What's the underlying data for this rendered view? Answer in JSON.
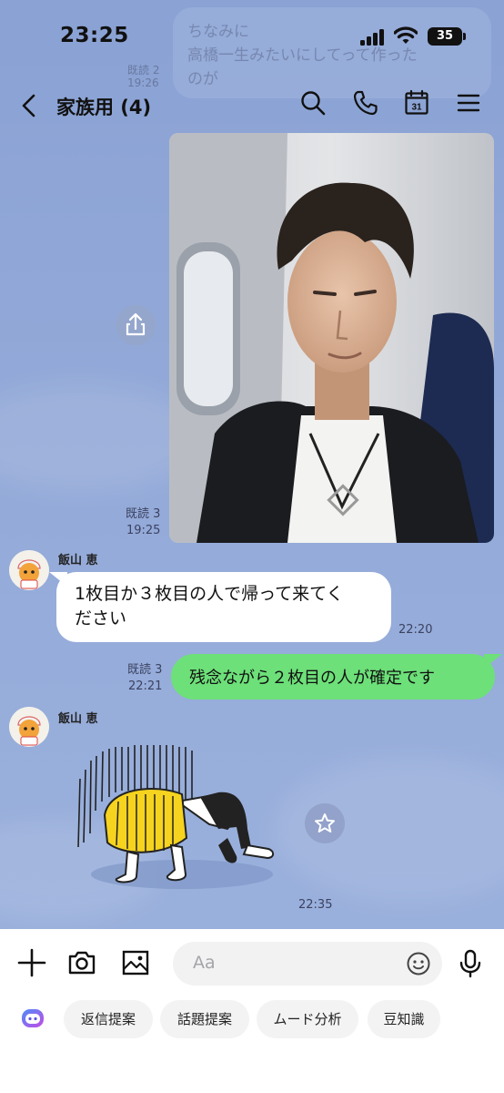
{
  "status_bar": {
    "time": "23:25",
    "battery": "35"
  },
  "ghost": {
    "lines": [
      "ちなみに",
      "高橋一生みたいにしてって作った",
      "のが"
    ],
    "read": "既読 2",
    "time": "19:26"
  },
  "header": {
    "title": "家族用 (4)"
  },
  "messages": {
    "photo_meta": {
      "read": "既読 3",
      "time": "19:25"
    },
    "incoming_1": {
      "sender": "飯山 恵",
      "lines": [
        "1枚目か３枚目の人で帰って来てく",
        "ださい"
      ],
      "time": "22:20"
    },
    "outgoing_1": {
      "text": "残念ながら２枚目の人が確定です",
      "read": "既読 3",
      "time": "22:21"
    },
    "incoming_2": {
      "sender": "飯山 恵",
      "time": "22:35"
    }
  },
  "input": {
    "placeholder": "Aa"
  },
  "suggestions": [
    "返信提案",
    "話題提案",
    "ムード分析",
    "豆知識"
  ],
  "colors": {
    "chat_bg": "#8fa6d6",
    "outgoing_bubble": "#6de079",
    "incoming_bubble": "#ffffff"
  },
  "icons": [
    "back-icon",
    "search-icon",
    "phone-icon",
    "calendar-icon",
    "menu-icon",
    "share-icon",
    "star-icon",
    "plus-icon",
    "camera-icon",
    "image-icon",
    "emoji-icon",
    "mic-icon",
    "ai-icon"
  ]
}
